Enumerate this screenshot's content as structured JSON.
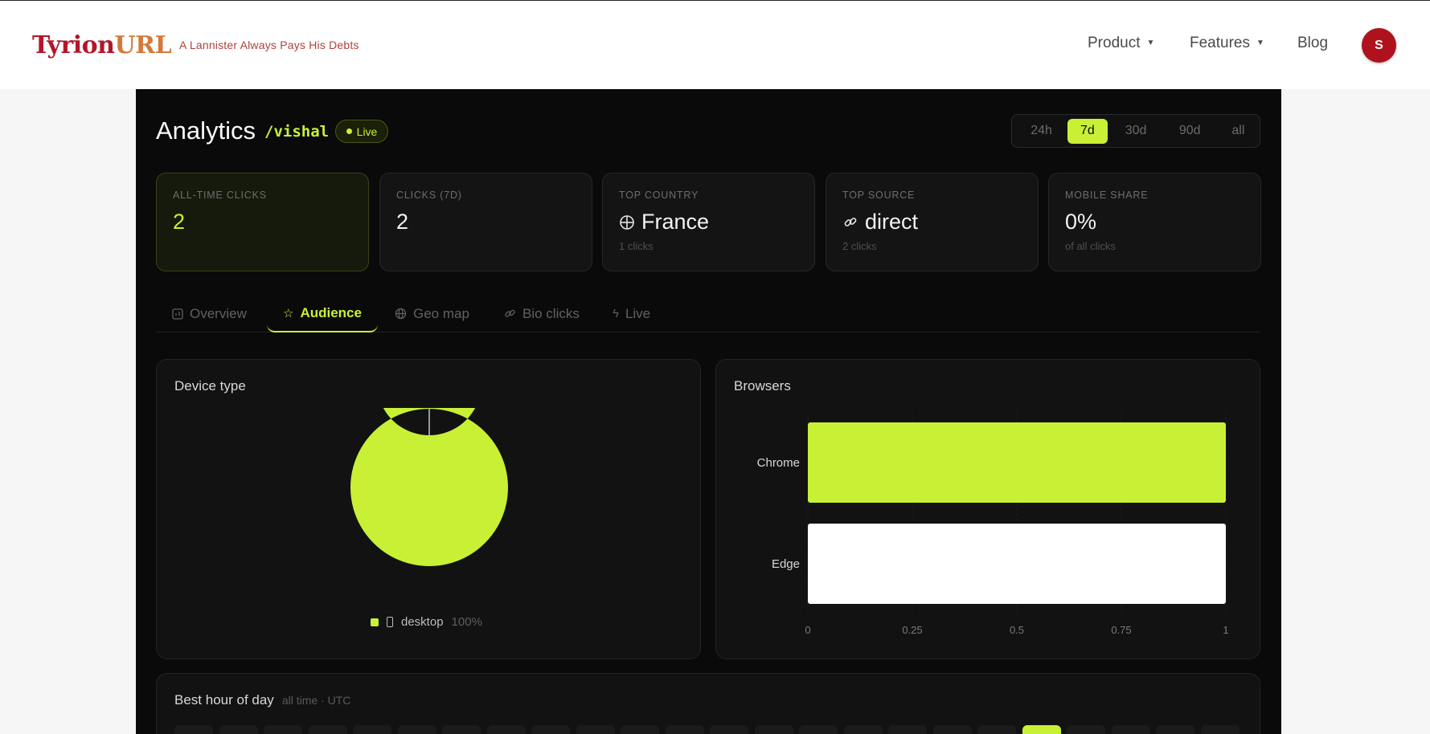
{
  "navbar": {
    "logo_part1": "Tyrion",
    "logo_part2": "URL",
    "tagline": "A Lannister Always Pays His Debts",
    "menu": {
      "product": "Product",
      "features": "Features",
      "blog": "Blog"
    },
    "avatar_initial": "S"
  },
  "header": {
    "title": "Analytics",
    "slug": "/vishal",
    "live_badge": "Live",
    "ranges": [
      "24h",
      "7d",
      "30d",
      "90d",
      "all"
    ],
    "active_range": "7d"
  },
  "stats": [
    {
      "label": "ALL-TIME CLICKS",
      "value": "2",
      "sub": ""
    },
    {
      "label": "CLICKS (7D)",
      "value": "2",
      "sub": ""
    },
    {
      "label": "TOP COUNTRY",
      "value": "France",
      "sub": "1 clicks",
      "icon": "globe-icon"
    },
    {
      "label": "TOP SOURCE",
      "value": "direct",
      "sub": "2 clicks",
      "icon": "link-icon"
    },
    {
      "label": "MOBILE SHARE",
      "value": "0%",
      "sub": "of all clicks"
    }
  ],
  "tabs": [
    {
      "label": "Overview",
      "icon": "chart-icon"
    },
    {
      "label": "Audience",
      "icon": "star-icon",
      "active": true
    },
    {
      "label": "Geo map",
      "icon": "globe-icon"
    },
    {
      "label": "Bio clicks",
      "icon": "link-icon"
    },
    {
      "label": "Live",
      "icon": "lightning-icon"
    }
  ],
  "device_panel": {
    "title": "Device type",
    "legend_label": "desktop",
    "legend_pct": "100%"
  },
  "browser_panel": {
    "title": "Browsers"
  },
  "best_hour": {
    "title": "Best hour of day",
    "subtitle": "all time · UTC"
  },
  "colors": {
    "accent": "#c8f135",
    "brand": "#b3172b"
  },
  "chart_data": [
    {
      "type": "pie",
      "title": "Device type",
      "labels": [
        "desktop"
      ],
      "values": [
        100
      ]
    },
    {
      "type": "bar",
      "orientation": "horizontal",
      "title": "Browsers",
      "categories": [
        "Chrome",
        "Edge"
      ],
      "values": [
        1,
        1
      ],
      "colors": [
        "#c8f135",
        "#ffffff"
      ],
      "xlim": [
        0,
        1
      ],
      "xticks": [
        "0",
        "0.25",
        "0.5",
        "0.75",
        "1"
      ],
      "grid": true
    }
  ]
}
